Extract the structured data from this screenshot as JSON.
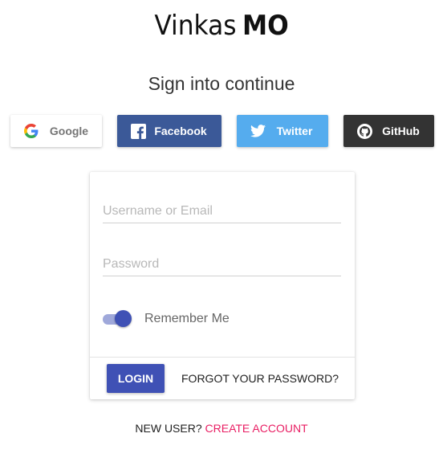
{
  "brand": {
    "name_light": "Vinkas",
    "name_bold": "MO"
  },
  "heading": "Sign into continue",
  "social": {
    "google": {
      "label": "Google",
      "icon": "google-icon",
      "color": "#ffffff"
    },
    "facebook": {
      "label": "Facebook",
      "icon": "facebook-icon",
      "color": "#3b5998"
    },
    "twitter": {
      "label": "Twitter",
      "icon": "twitter-icon",
      "color": "#55acee"
    },
    "github": {
      "label": "GitHub",
      "icon": "github-icon",
      "color": "#333333"
    }
  },
  "form": {
    "username_placeholder": "Username or Email",
    "username_value": "",
    "password_placeholder": "Password",
    "password_value": "",
    "remember_label": "Remember Me",
    "remember_checked": true,
    "login_label": "LOGIN",
    "forgot_label": "FORGOT YOUR PASSWORD?"
  },
  "footer": {
    "new_user": "NEW USER?",
    "create_account": "CREATE ACCOUNT"
  },
  "colors": {
    "primary": "#3f51b5",
    "accent": "#e91e63"
  }
}
